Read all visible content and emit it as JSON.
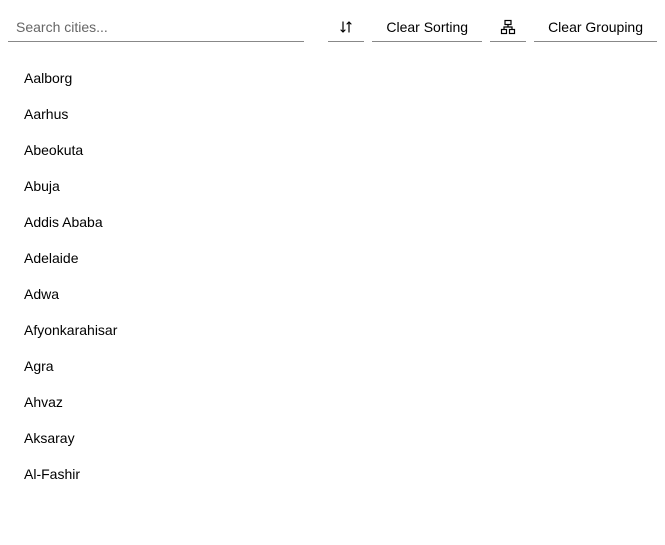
{
  "search": {
    "placeholder": "Search cities...",
    "value": ""
  },
  "toolbar": {
    "sort_icon": "sort-arrows-icon",
    "clear_sorting_label": "Clear Sorting",
    "group_icon": "group-icon",
    "clear_grouping_label": "Clear Grouping"
  },
  "list": {
    "items": [
      "Aalborg",
      "Aarhus",
      "Abeokuta",
      "Abuja",
      "Addis Ababa",
      "Adelaide",
      "Adwa",
      "Afyonkarahisar",
      "Agra",
      "Ahvaz",
      "Aksaray",
      "Al-Fashir"
    ]
  }
}
